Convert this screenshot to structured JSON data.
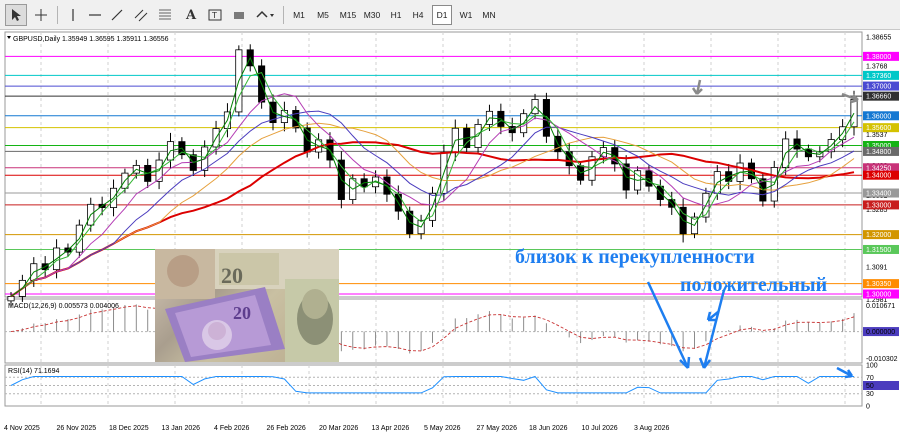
{
  "toolbar": {
    "timeframes": [
      "M1",
      "M5",
      "M15",
      "M30",
      "H1",
      "H4",
      "D1",
      "W1",
      "MN"
    ],
    "active_timeframe": "D1",
    "tools": [
      "cursor-icon",
      "crosshair-icon",
      "vertical-line-icon",
      "horizontal-line-icon",
      "trend-line-icon",
      "equidistant-channel-icon",
      "fibonacci-icon",
      "text-icon",
      "text-label-icon",
      "rectangle-icon",
      "arrows-dropdown-icon"
    ]
  },
  "chart_header": {
    "symbol_line": "GBPUSD,Daily  1.35949 1.36595 1.35911 1.36556"
  },
  "macd": {
    "label": "MACD(12,26,9) 0.005573 0.004006",
    "scale": [
      "0.010671",
      "0.000000",
      "-0.010302"
    ]
  },
  "rsi": {
    "label": "RSI(14) 71.1694",
    "scale": [
      "100",
      "70",
      "50",
      "30",
      "0"
    ]
  },
  "annotations": {
    "line1": "близок к перекупленности",
    "line2": "положительный"
  },
  "chart_data": {
    "type": "line",
    "symbol": "GBPUSD",
    "timeframe": "Daily",
    "ohlc": {
      "open": 1.35949,
      "high": 1.36595,
      "low": 1.35911,
      "close": 1.36556
    },
    "x_tick_labels": [
      "4 Nov 2025",
      "26 Nov 2025",
      "18 Dec 2025",
      "13 Jan 2026",
      "4 Feb 2026",
      "26 Feb 2026",
      "20 Mar 2026",
      "13 Apr 2026",
      "5 May 2026",
      "27 May 2026",
      "18 Jun 2026",
      "10 Jul 2026",
      "3 Aug 2026"
    ],
    "price_scale_labels": [
      1.38655,
      1.3768,
      1.3537,
      1.3433,
      1.3331,
      1.3285,
      1.3155,
      1.3091,
      1.2981
    ],
    "ylim": [
      1.299,
      1.3882
    ],
    "close_series": [
      1.2992,
      1.3046,
      1.3102,
      1.3082,
      1.3155,
      1.3141,
      1.3232,
      1.3302,
      1.3291,
      1.3356,
      1.3407,
      1.3433,
      1.3379,
      1.3451,
      1.3513,
      1.3469,
      1.3416,
      1.3495,
      1.3557,
      1.3613,
      1.3822,
      1.3768,
      1.3646,
      1.3577,
      1.3618,
      1.3559,
      1.3478,
      1.3519,
      1.3451,
      1.3318,
      1.3388,
      1.3361,
      1.3394,
      1.3336,
      1.3279,
      1.3203,
      1.3248,
      1.3339,
      1.3477,
      1.3558,
      1.3493,
      1.3571,
      1.3615,
      1.3564,
      1.3543,
      1.3607,
      1.3655,
      1.3531,
      1.3479,
      1.3432,
      1.3383,
      1.3462,
      1.3493,
      1.3438,
      1.335,
      1.3415,
      1.3363,
      1.3318,
      1.3292,
      1.3203,
      1.3259,
      1.3339,
      1.3412,
      1.3379,
      1.3441,
      1.3388,
      1.3313,
      1.3426,
      1.3522,
      1.3488,
      1.3462,
      1.3479,
      1.352,
      1.3563,
      1.3655
    ],
    "levels": [
      {
        "price": 1.38,
        "label": "1.38000",
        "color": "#ff00ff"
      },
      {
        "price": 1.3736,
        "label": "1.37360",
        "color": "#00c8c8"
      },
      {
        "price": 1.37,
        "label": "1.37000",
        "color": "#4b4bd2"
      },
      {
        "price": 1.3666,
        "label": "1.36660",
        "color": "#303030"
      },
      {
        "price": 1.36,
        "label": "1.36000",
        "color": "#1478d2"
      },
      {
        "price": 1.356,
        "label": "1.35600",
        "color": "#d4c200"
      },
      {
        "price": 1.35,
        "label": "1.35000",
        "color": "#14b414"
      },
      {
        "price": 1.348,
        "label": "1.34800",
        "color": "#6a6a6a"
      },
      {
        "price": 1.3425,
        "label": "1.34250",
        "color": "#c83278"
      },
      {
        "price": 1.34,
        "label": "1.34000",
        "color": "#dc0000"
      },
      {
        "price": 1.334,
        "label": "1.33400",
        "color": "#9a9a9a"
      },
      {
        "price": 1.33,
        "label": "1.33000",
        "color": "#c81e1e"
      },
      {
        "price": 1.32,
        "label": "1.32000",
        "color": "#d29600"
      },
      {
        "price": 1.315,
        "label": "1.31500",
        "color": "#5ac85a"
      },
      {
        "price": 1.3035,
        "label": "1.30350",
        "color": "#ff8c00"
      },
      {
        "price": 1.3,
        "label": "1.30000",
        "color": "#ff00ff"
      }
    ],
    "moving_averages": [
      {
        "color": "#dc0000",
        "period": 200
      },
      {
        "color": "#e6a03c",
        "period": 100
      },
      {
        "color": "#4b3cbe",
        "period": 50
      },
      {
        "color": "#b43cb4",
        "period": 21
      },
      {
        "color": "#32b432",
        "period": 9
      },
      {
        "color": "#008000",
        "period": 5
      }
    ],
    "macd_range": [
      -0.010302,
      0.010671
    ],
    "rsi_levels": [
      30,
      50,
      70
    ],
    "rsi_current": 71.1694,
    "grid": true
  }
}
